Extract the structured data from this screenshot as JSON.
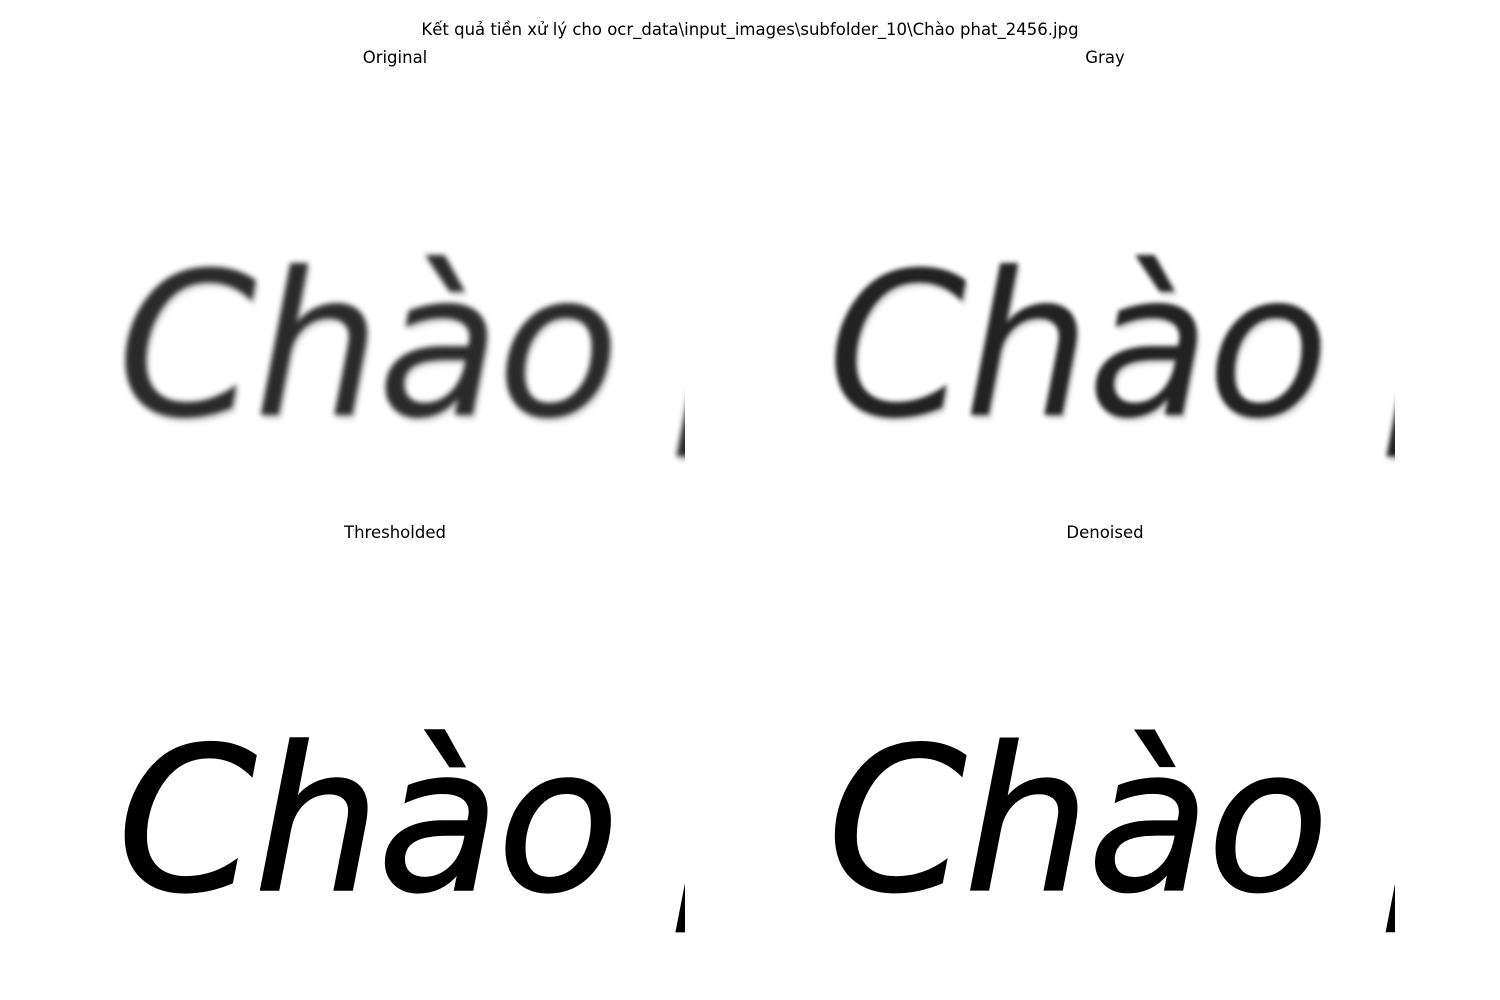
{
  "figure": {
    "suptitle": "Kết quả tiền xử lý cho ocr_data\\input_images\\subfolder_10\\Chào phat_2456.jpg"
  },
  "panels": [
    {
      "title": "Original",
      "image_text": "Chào phat",
      "style": "blurred"
    },
    {
      "title": "Gray",
      "image_text": "Chào phat",
      "style": "blurred-gray"
    },
    {
      "title": "Thresholded",
      "image_text": "Chào phat",
      "style": "binary"
    },
    {
      "title": "Denoised",
      "image_text": "Chào phat",
      "style": "binary"
    }
  ],
  "colors": {
    "background": "#ffffff",
    "ink_blurred": "#2a2a2a",
    "ink_binary": "#000000"
  }
}
